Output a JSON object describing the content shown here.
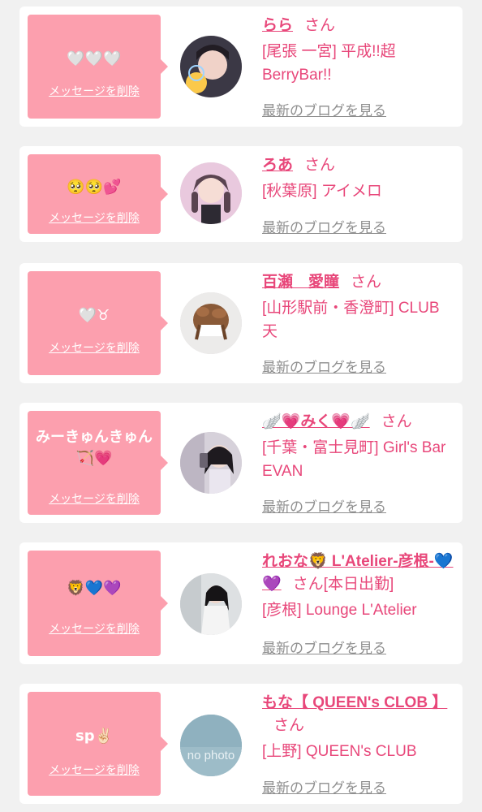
{
  "cards": [
    {
      "message": "🤍🤍🤍",
      "delete_label": "メッセージを削除",
      "name": "らら",
      "san": "さん",
      "shop": "[尾張 一宮] 平成!!超BerryBar!!",
      "blog_label": "最新のブログを見る",
      "avatar": "profile-photo"
    },
    {
      "message": "🥺🥺💕",
      "delete_label": "メッセージを削除",
      "name": "ろあ",
      "san": "さん",
      "shop": "[秋葉原] アイメロ",
      "blog_label": "最新のブログを見る",
      "avatar": "profile-photo"
    },
    {
      "message": "🤍♉",
      "delete_label": "メッセージを削除",
      "name": "百瀬　愛瞳",
      "san": "さん",
      "shop": "[山形駅前・香澄町] CLUB 天",
      "blog_label": "最新のブログを見る",
      "avatar": "profile-photo"
    },
    {
      "message": "みーきゅんきゅん🏹💗",
      "delete_label": "メッセージを削除",
      "name": "🪽💗みく💗🪽",
      "san": "さん",
      "shop": "[千葉・富士見町] Girl's Bar EVAN",
      "blog_label": "最新のブログを見る",
      "avatar": "profile-photo"
    },
    {
      "message": "🦁💙💜",
      "delete_label": "メッセージを削除",
      "name": "れおな🦁 L'Atelier-彦根-💙💜",
      "san": "さん[本日出勤]",
      "shop": "[彦根] Lounge L'Atelier",
      "blog_label": "最新のブログを見る",
      "avatar": "profile-photo"
    },
    {
      "message": "sp✌🏻",
      "delete_label": "メッセージを削除",
      "name": "もな【 QUEEN's CLOB 】",
      "san": "さん",
      "shop": "[上野] QUEEN's CLUB",
      "blog_label": "最新のブログを見る",
      "avatar": "no-photo",
      "avatar_text": "no photo"
    }
  ],
  "colors": {
    "accent": "#e8477a",
    "bubble": "#fc9fae",
    "link_gray": "#8e8e8e",
    "background": "#f1f1f1"
  }
}
